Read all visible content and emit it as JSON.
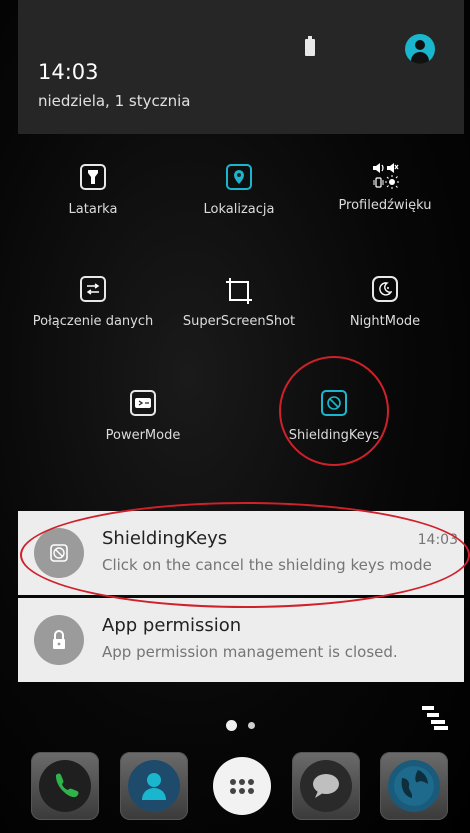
{
  "status": {
    "time": "14:03",
    "date": "niedziela, 1 stycznia"
  },
  "quick_settings": [
    {
      "label": "Latarka",
      "icon": "flashlight-icon"
    },
    {
      "label": "Lokalizacja",
      "icon": "location-icon"
    },
    {
      "label": "Profiledźwięku",
      "icon": "sound-profile-icon"
    },
    {
      "label": "Połączenie danych",
      "icon": "data-connection-icon"
    },
    {
      "label": "SuperScreenShot",
      "icon": "screenshot-icon"
    },
    {
      "label": "NightMode",
      "icon": "night-mode-icon"
    },
    {
      "label": "PowerMode",
      "icon": "power-mode-icon"
    },
    {
      "label": "ShieldingKeys",
      "icon": "shielding-keys-icon"
    }
  ],
  "notifications": [
    {
      "title": "ShieldingKeys",
      "body": "Click on the cancel the shielding keys mode",
      "time": "14:03",
      "icon": "shielding-keys-icon"
    },
    {
      "title": "App permission",
      "body": "App permission management is closed.",
      "time": "",
      "icon": "lock-icon"
    }
  ],
  "dock": [
    "phone-icon",
    "contacts-icon",
    "app-drawer-icon",
    "messages-icon",
    "browser-icon"
  ],
  "colors": {
    "highlight": "#d0202a",
    "accent": "#19b6ce",
    "notification_bg": "#ededed"
  }
}
